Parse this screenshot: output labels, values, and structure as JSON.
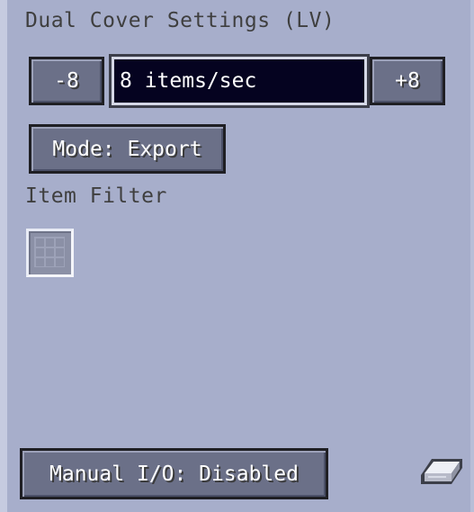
{
  "panel": {
    "title": "Dual Cover Settings (LV)"
  },
  "rate": {
    "decrease_label": "-8",
    "increase_label": "+8",
    "value": "8 items/sec"
  },
  "mode": {
    "label": "Mode: Export"
  },
  "filter": {
    "label": "Item Filter",
    "slot_icon": "grid-slot-icon"
  },
  "manual_io": {
    "label": "Manual I/O: Disabled"
  },
  "corner_icon": "ingot-icon"
}
